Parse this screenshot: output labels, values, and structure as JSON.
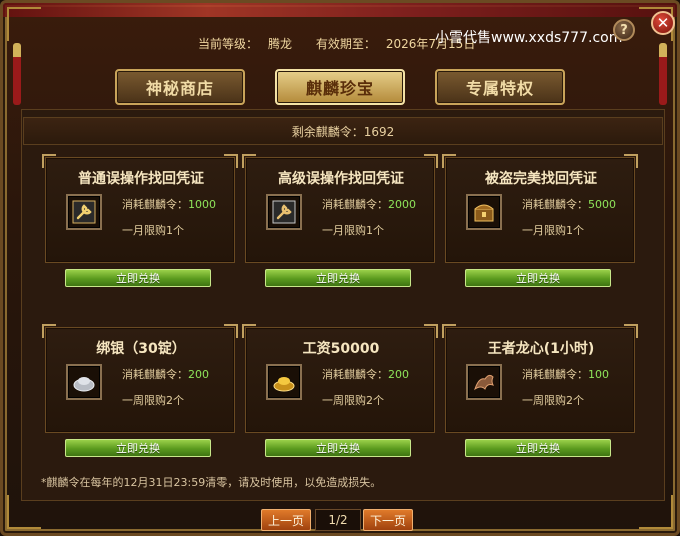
{
  "header": {
    "level_label": "当前等级：",
    "level_value": "腾龙",
    "expiry_label": "有效期至：",
    "expiry_value": "2026年7月15日",
    "watermark": "小雪代售www.xxds777.com"
  },
  "controls": {
    "help": "?",
    "close": "✕"
  },
  "tabs": [
    {
      "label": "神秘商店",
      "active": false
    },
    {
      "label": "麒麟珍宝",
      "active": true
    },
    {
      "label": "专属特权",
      "active": false
    }
  ],
  "remaining": "剩余麒麟令：1692",
  "cost_label": "消耗麒麟令：",
  "redeem_label": "立即兑换",
  "items": [
    {
      "title": "普通误操作找回凭证",
      "cost": "1000",
      "limit": "一月限购1个",
      "icon": "wrench-icon"
    },
    {
      "title": "高级误操作找回凭证",
      "cost": "2000",
      "limit": "一月限购1个",
      "icon": "wrench-icon"
    },
    {
      "title": "被盗完美找回凭证",
      "cost": "5000",
      "limit": "一月限购1个",
      "icon": "chest-icon"
    },
    {
      "title": "绑银（30锭）",
      "cost": "200",
      "limit": "一周限购2个",
      "icon": "silver-ingot-icon"
    },
    {
      "title": "工资50000",
      "cost": "200",
      "limit": "一周限购2个",
      "icon": "gold-ingot-icon"
    },
    {
      "title": "王者龙心(1小时)",
      "cost": "100",
      "limit": "一周限购2个",
      "icon": "dragon-icon"
    }
  ],
  "note": "*麒麟令在每年的12月31日23:59清零，请及时使用，以免造成损失。",
  "pager": {
    "prev": "上一页",
    "page": "1/2",
    "next": "下一页"
  },
  "colors": {
    "accent_gold": "#c9a45a",
    "cost_green": "#8ee45a",
    "button_green": "#5a9a1e"
  }
}
